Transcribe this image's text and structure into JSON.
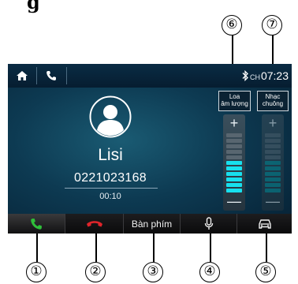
{
  "figure_title": "g",
  "statusbar": {
    "home_icon": "home-icon",
    "phone_icon": "phone-icon",
    "bluetooth_icon": "bluetooth-icon",
    "time_prefix": "CH",
    "time": "07:23"
  },
  "caller": {
    "avatar_icon": "person-avatar-icon",
    "name": "Lisi",
    "number": "0221023168",
    "duration": "00:10"
  },
  "sliders": [
    {
      "label_line1": "Loa",
      "label_line2": "âm lượng",
      "plus": "+",
      "minus": "—",
      "level": 0.55,
      "enabled": true
    },
    {
      "label_line1": "Nhạc",
      "label_line2": "chuông",
      "plus": "+",
      "minus": "—",
      "level": 0.55,
      "enabled": false
    }
  ],
  "bottombar": {
    "answer_icon": "phone-answer-icon",
    "hangup_icon": "phone-hangup-icon",
    "keypad_label": "Bàn phím",
    "mic_icon": "microphone-icon",
    "car_icon": "car-icon"
  },
  "callouts": [
    "①",
    "②",
    "③",
    "④",
    "⑤",
    "⑥",
    "⑦"
  ],
  "colors": {
    "answer": "#2fbf3a",
    "hangup": "#e0242a",
    "level_active": "#17e0ee",
    "level_dim": "#0d8e96"
  }
}
